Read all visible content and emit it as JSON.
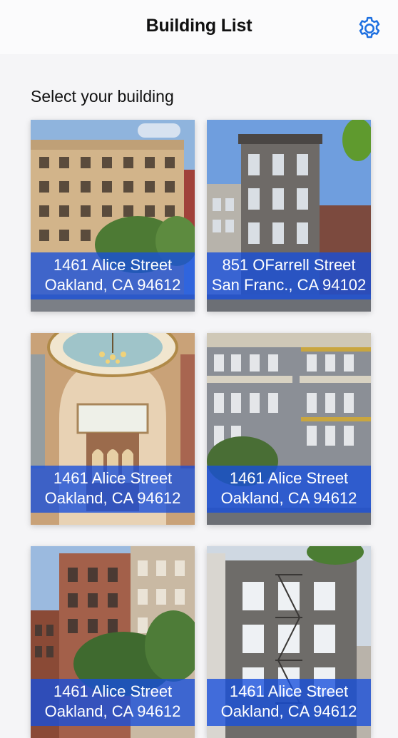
{
  "header": {
    "title": "Building List",
    "settings_icon": "gear-icon",
    "accent_color": "#1d6fe0"
  },
  "main": {
    "section_label": "Select your building",
    "buildings": [
      {
        "street": "1461 Alice Street",
        "city": "Oakland, CA 94612"
      },
      {
        "street": "851 OFarrell Street",
        "city": "San Franc., CA 94102"
      },
      {
        "street": "1461 Alice Street",
        "city": "Oakland, CA 94612"
      },
      {
        "street": "1461 Alice Street",
        "city": "Oakland, CA 94612"
      },
      {
        "street": "1461 Alice Street",
        "city": "Oakland, CA 94612"
      },
      {
        "street": "1461 Alice Street",
        "city": "Oakland, CA 94612"
      }
    ]
  }
}
